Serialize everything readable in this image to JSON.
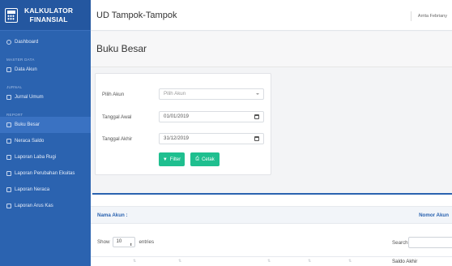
{
  "sidebar": {
    "brand": "KALKULATOR\nFINANSIAL",
    "brand_line1": "KALKULATOR",
    "brand_line2": "FINANSIAL",
    "items": [
      {
        "label": "Dashboard",
        "icon": "dashboard-icon"
      },
      {
        "section": "MASTER DATA"
      },
      {
        "label": "Data Akun",
        "icon": "list-icon"
      },
      {
        "section": "JURNAL"
      },
      {
        "label": "Jurnal Umum",
        "icon": "book-icon"
      },
      {
        "section": "REPORT"
      },
      {
        "label": "Buku Besar",
        "icon": "list-icon"
      },
      {
        "label": "Neraca Saldo",
        "icon": "table-icon"
      },
      {
        "label": "Laporan Laba Rugi",
        "icon": "file-icon"
      },
      {
        "label": "Laporan Perubahan Ekuitas",
        "icon": "file-icon"
      },
      {
        "label": "Laporan Neraca",
        "icon": "file-icon"
      },
      {
        "label": "Laporan Arus Kas",
        "icon": "file-icon"
      }
    ]
  },
  "topbar": {
    "app_title": "UD Tampok-Tampok",
    "user_name": "Arrita Febriany"
  },
  "page": {
    "title": "Buku Besar"
  },
  "filter": {
    "akun_label": "Pilih Akun",
    "akun_value": "Pilih Akun",
    "tgl_awal_label": "Tanggal Awal",
    "tgl_awal_value": "01/01/2019",
    "tgl_akhir_label": "Tanggal Akhir",
    "tgl_akhir_value": "31/12/2019",
    "filter_button": "Filter",
    "cetak_button": "Cetak"
  },
  "table": {
    "nama_akun_label": "Nama Akun :",
    "nomor_akun_label": "Nomor Akun",
    "show_label": "Show",
    "entries_value": "10",
    "entries_label": "entries",
    "search_label": "Search:",
    "saldo_akhir_header": "Saldo Akhir"
  },
  "colors": {
    "sidebar": "#2b63b0",
    "accent": "#1fbf8f"
  }
}
